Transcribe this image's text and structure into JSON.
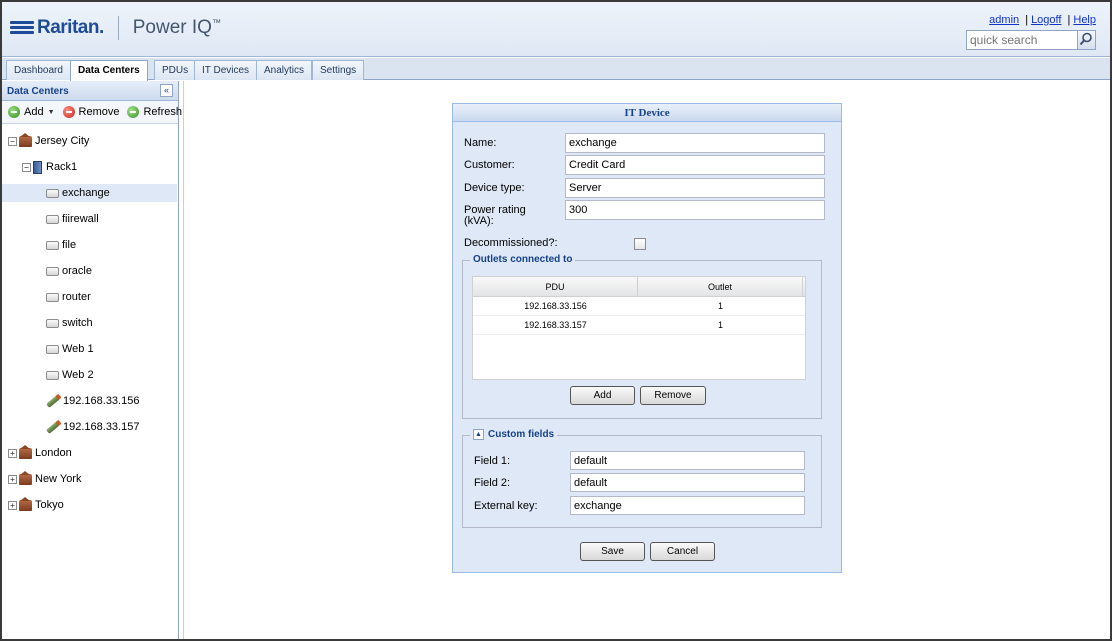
{
  "app": {
    "brand": "Raritan.",
    "product": "Power IQ",
    "product_mark": "™"
  },
  "top_links": {
    "admin": "admin",
    "logoff": "Logoff",
    "help": "Help",
    "separator": "|"
  },
  "search": {
    "placeholder": "quick search"
  },
  "tabs": [
    {
      "label": "Dashboard",
      "active": false
    },
    {
      "label": "Data Centers",
      "active": true
    },
    {
      "label": "PDUs",
      "active": false
    },
    {
      "label": "IT Devices",
      "active": false
    },
    {
      "label": "Analytics",
      "active": false
    },
    {
      "label": "Settings",
      "active": false
    }
  ],
  "left_panel": {
    "title": "Data Centers",
    "collapse_glyph": "«",
    "toolbar": {
      "add": "Add",
      "remove": "Remove",
      "refresh": "Refresh"
    },
    "tree": [
      {
        "label": "Jersey City",
        "type": "datacenter",
        "expander": "−"
      },
      {
        "label": "Rack1",
        "type": "rack",
        "expander": "−"
      },
      {
        "label": "exchange",
        "type": "device",
        "selected": true
      },
      {
        "label": "fiirewall",
        "type": "device"
      },
      {
        "label": "file",
        "type": "device"
      },
      {
        "label": "oracle",
        "type": "device"
      },
      {
        "label": "router",
        "type": "device"
      },
      {
        "label": "switch",
        "type": "device"
      },
      {
        "label": "Web 1",
        "type": "device"
      },
      {
        "label": "Web 2",
        "type": "device"
      },
      {
        "label": "192.168.33.156",
        "type": "pdu"
      },
      {
        "label": "192.168.33.157",
        "type": "pdu"
      },
      {
        "label": "London",
        "type": "datacenter",
        "expander": "+"
      },
      {
        "label": "New York",
        "type": "datacenter",
        "expander": "+"
      },
      {
        "label": "Tokyo",
        "type": "datacenter",
        "expander": "+"
      }
    ]
  },
  "dialog": {
    "title": "IT Device",
    "fields": {
      "name": {
        "label": "Name:",
        "value": "exchange"
      },
      "customer": {
        "label": "Customer:",
        "value": "Credit Card"
      },
      "device_type": {
        "label": "Device type:",
        "value": "Server"
      },
      "power_rating": {
        "label_line1": "Power rating",
        "label_line2": "(kVA):",
        "value": "300"
      },
      "decommissioned": {
        "label": "Decommissioned?:",
        "checked": false
      }
    },
    "outlets": {
      "legend": "Outlets connected to",
      "columns": [
        "PDU",
        "Outlet"
      ],
      "rows": [
        {
          "pdu": "192.168.33.156",
          "outlet": "1"
        },
        {
          "pdu": "192.168.33.157",
          "outlet": "1"
        }
      ],
      "add_label": "Add",
      "remove_label": "Remove"
    },
    "custom_fields": {
      "legend": "Custom fields",
      "toggle_glyph": "▲",
      "field1": {
        "label": "Field 1:",
        "value": "default"
      },
      "field2": {
        "label": "Field 2:",
        "value": "default"
      },
      "external_key": {
        "label": "External key:",
        "value": "exchange"
      }
    },
    "save_label": "Save",
    "cancel_label": "Cancel"
  }
}
